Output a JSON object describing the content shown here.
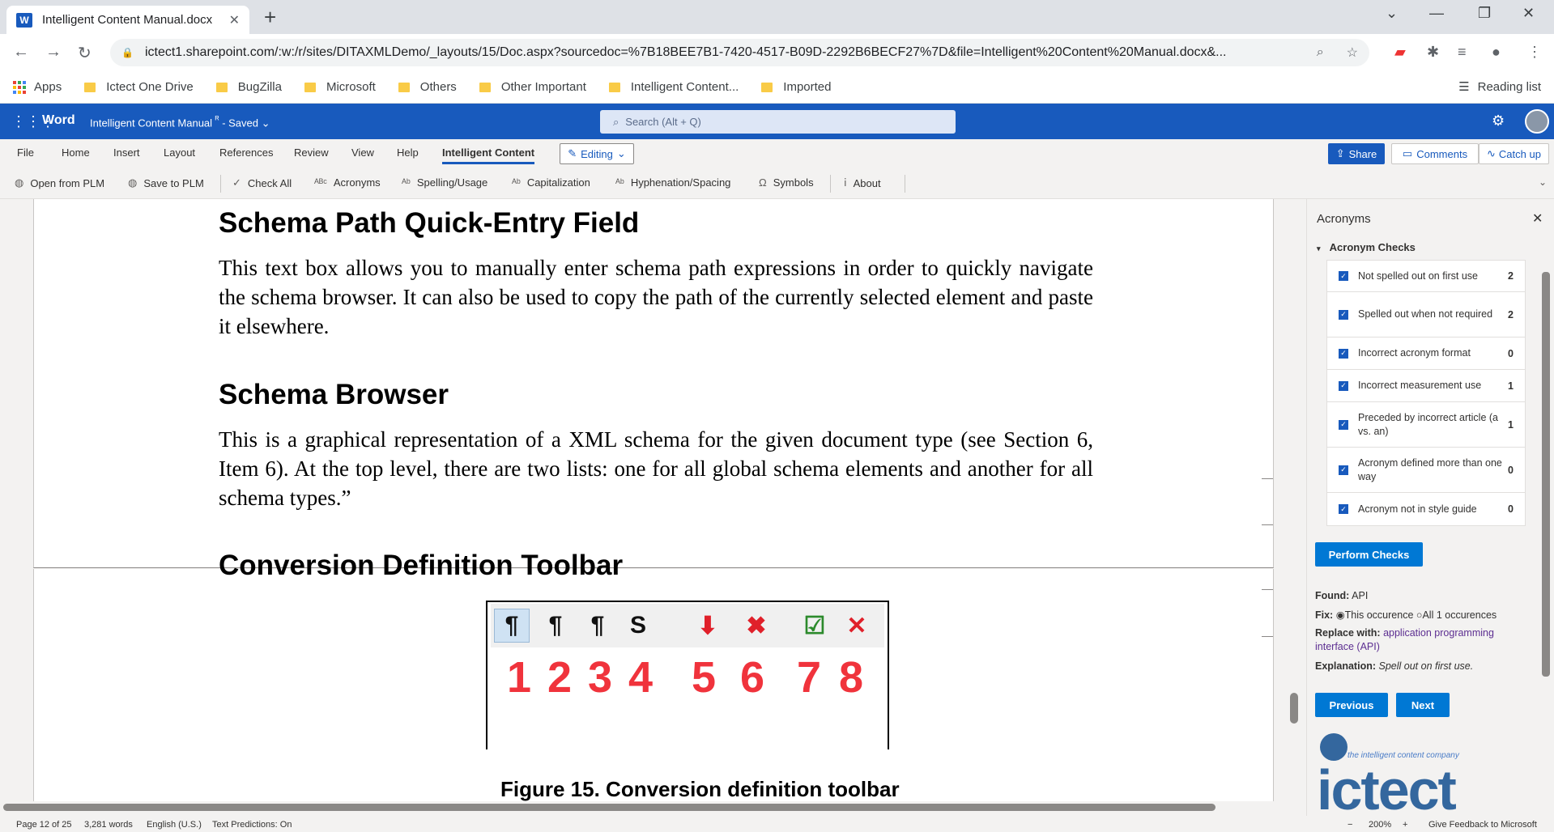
{
  "browser": {
    "tab_title": "Intelligent Content Manual.docx",
    "url": "ictect1.sharepoint.com/:w:/r/sites/DITAXMLDemo/_layouts/15/Doc.aspx?sourcedoc=%7B18BEE7B1-7420-4517-B09D-2292B6BECF27%7D&file=Intelligent%20Content%20Manual.docx&...",
    "bookmarks": [
      "Apps",
      "Ictect One Drive",
      "BugZilla",
      "Microsoft",
      "Others",
      "Other Important",
      "Intelligent Content...",
      "Imported"
    ],
    "reading_list": "Reading list"
  },
  "word": {
    "app_name": "Word",
    "doc_title": "Intelligent Content Manual",
    "doc_status": "- Saved",
    "search_placeholder": "Search (Alt + Q)",
    "menu_tabs": [
      "File",
      "Home",
      "Insert",
      "Layout",
      "References",
      "Review",
      "View",
      "Help",
      "Intelligent Content"
    ],
    "editing_label": "Editing",
    "share_label": "Share",
    "comments_label": "Comments",
    "catchup_label": "Catch up",
    "commands": [
      "Open from PLM",
      "Save to PLM",
      "Check All",
      "Acronyms",
      "Spelling/Usage",
      "Capitalization",
      "Hyphenation/Spacing",
      "Symbols",
      "About"
    ]
  },
  "document": {
    "heading1": "Schema Path Quick-Entry Field",
    "para1": "This text box allows you to manually enter schema path expressions in order to quickly navigate the schema browser. It can also be used to copy the path of the currently selected element and paste it elsewhere.",
    "heading2": "Schema Browser",
    "para2": "This is a graphical representation of a XML schema for the given document type (see Section 6, Item 6). At the top level, there are two lists: one for all global schema elements and another for all schema types.”",
    "heading3": "Conversion Definition Toolbar",
    "figure_numbers": [
      "1",
      "2",
      "3",
      "4",
      "5",
      "6",
      "7",
      "8"
    ],
    "figure_caption": "Figure 15.  Conversion definition toolbar"
  },
  "pane": {
    "title": "Acronyms",
    "section": "Acronym Checks",
    "checks": [
      {
        "label": "Not spelled out on first use",
        "count": "2"
      },
      {
        "label": "Spelled out when not required",
        "count": "2"
      },
      {
        "label": "Incorrect acronym format",
        "count": "0"
      },
      {
        "label": "Incorrect measurement use",
        "count": "1"
      },
      {
        "label": "Preceded by incorrect article (a vs. an)",
        "count": "1"
      },
      {
        "label": "Acronym defined more than one way",
        "count": "0"
      },
      {
        "label": "Acronym not in style guide",
        "count": "0"
      }
    ],
    "perform_label": "Perform Checks",
    "found_label": "Found:",
    "found_value": "API",
    "fix_label": "Fix:",
    "fix_option1": "This occurence",
    "fix_option2": "All 1 occurences",
    "replace_label": "Replace with:",
    "replace_value": "application programming interface (API)",
    "explanation_label": "Explanation:",
    "explanation_value": "Spell out on first use.",
    "previous_label": "Previous",
    "next_label": "Next",
    "logo_tagline": "the intelligent content company",
    "logo_word": "ictect"
  },
  "status": {
    "page": "Page 12 of 25",
    "words": "3,281 words",
    "language": "English (U.S.)",
    "predictions": "Text Predictions: On",
    "zoom": "200%",
    "feedback": "Give Feedback to Microsoft"
  }
}
